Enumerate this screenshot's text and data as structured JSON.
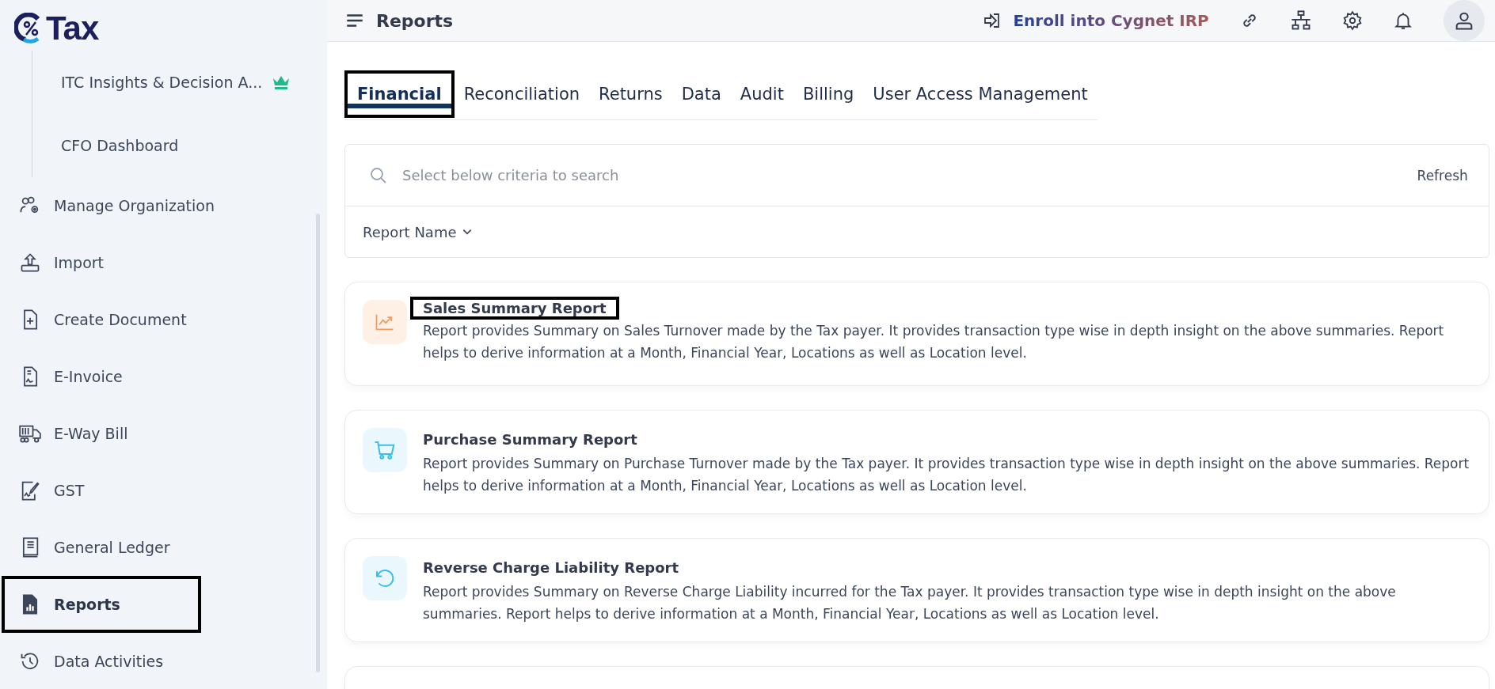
{
  "logo": {
    "text": "Tax"
  },
  "sidebar": {
    "sub_items": [
      {
        "label": "ITC Insights & Decision A...",
        "premium": true
      },
      {
        "label": "CFO Dashboard",
        "premium": false
      }
    ],
    "items": [
      {
        "label": "Manage Organization",
        "kind": "org",
        "selected": false,
        "highlighted": false
      },
      {
        "label": "Import",
        "kind": "import",
        "selected": false,
        "highlighted": false
      },
      {
        "label": "Create Document",
        "kind": "create",
        "selected": false,
        "highlighted": false
      },
      {
        "label": "E-Invoice",
        "kind": "invoice",
        "selected": false,
        "highlighted": false
      },
      {
        "label": "E-Way Bill",
        "kind": "truck",
        "selected": false,
        "highlighted": false
      },
      {
        "label": "GST",
        "kind": "gst",
        "selected": false,
        "highlighted": false
      },
      {
        "label": "General Ledger",
        "kind": "ledger",
        "selected": false,
        "highlighted": false
      },
      {
        "label": "Reports",
        "kind": "reports",
        "selected": true,
        "highlighted": true
      },
      {
        "label": "Data Activities",
        "kind": "history",
        "selected": false,
        "highlighted": false
      }
    ]
  },
  "header": {
    "title": "Reports",
    "enroll_link": "Enroll into Cygnet IRP"
  },
  "tabs": [
    {
      "label": "Financial",
      "selected": true,
      "highlighted": true
    },
    {
      "label": "Reconciliation",
      "selected": false,
      "highlighted": false
    },
    {
      "label": "Returns",
      "selected": false,
      "highlighted": false
    },
    {
      "label": "Data",
      "selected": false,
      "highlighted": false
    },
    {
      "label": "Audit",
      "selected": false,
      "highlighted": false
    },
    {
      "label": "Billing",
      "selected": false,
      "highlighted": false
    },
    {
      "label": "User Access Management",
      "selected": false,
      "highlighted": false
    }
  ],
  "search": {
    "placeholder": "Select below criteria to search",
    "refresh": "Refresh",
    "filter": "Report Name"
  },
  "reports": [
    {
      "title": "Sales Summary Report",
      "kind": "chart",
      "highlighted": true,
      "description": "Report provides Summary on Sales Turnover made by the Tax payer. It provides transaction type wise in depth insight on the above summaries. Report helps to derive information at a Month, Financial Year, Locations as well as Location level."
    },
    {
      "title": "Purchase Summary Report",
      "kind": "cart",
      "highlighted": false,
      "description": "Report provides Summary on Purchase Turnover made by the Tax payer. It provides transaction type wise in depth insight on the above summaries. Report helps to derive information at a Month, Financial Year, Locations as well as Location level."
    },
    {
      "title": "Reverse Charge Liability Report",
      "kind": "undo",
      "highlighted": false,
      "description": "Report provides Summary on Reverse Charge Liability incurred for the Tax payer. It provides transaction type wise in depth insight on the above summaries. Report helps to derive information at a Month, Financial Year, Locations as well as Location level."
    }
  ]
}
